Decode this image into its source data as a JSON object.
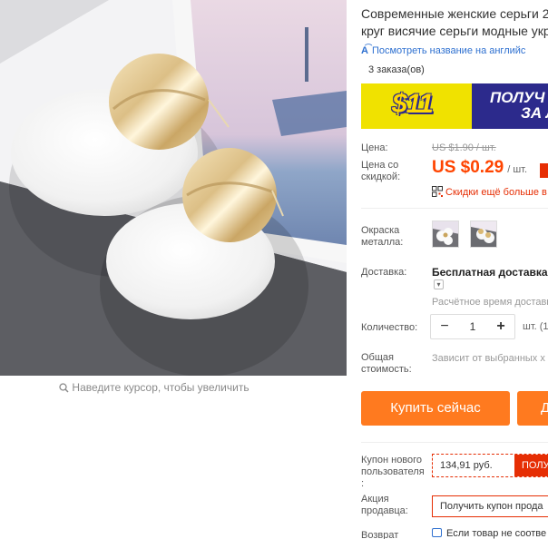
{
  "product": {
    "title_line1": "Современные женские серьги 2",
    "title_line2": "круг висячие серьги модные укр",
    "translate_link": "Посмотреть название на английс",
    "orders": "3 заказа(ов)"
  },
  "banner": {
    "amount": "$11",
    "slogan_line1": "ПОЛУЧ",
    "slogan_line2": "ЗА Л",
    "colors": {
      "background": "#2c2a8c",
      "amount_bg": "#f0e200",
      "amount": "#ffd800"
    }
  },
  "pricing": {
    "price_label": "Цена:",
    "old_price": "US $1.90 / шт.",
    "discount_label_line1": "Цена со",
    "discount_label_line2": "скидкой:",
    "price": "US $0.29",
    "unit": "/ шт.",
    "more_discounts": "Скидки ещё больше в",
    "accent_color": "#ff4400"
  },
  "options": {
    "color_label_line1": "Окраска",
    "color_label_line2": "металла:"
  },
  "shipping": {
    "label": "Доставка:",
    "title": "Бесплатная доставка в",
    "toggle": "▾",
    "eta": "Расчётное время доставк"
  },
  "quantity": {
    "label": "Количество:",
    "minus": "−",
    "value": "1",
    "plus": "+",
    "unit": "шт. (1"
  },
  "total": {
    "label_line1": "Общая",
    "label_line2": "стоимость:",
    "hint": "Зависит от выбранных х"
  },
  "actions": {
    "buy_now": "Купить сейчас",
    "add_to_cart": "Д",
    "button_color": "#ff7a1f"
  },
  "coupons": {
    "new_user_label_line1": "Купон нового",
    "new_user_label_line2": "пользователя",
    "new_user_label_line3": ":",
    "new_user_amount": "134,91 руб.",
    "new_user_get": "ПОЛУ",
    "seller_label_line1": "Акция",
    "seller_label_line2": "продавца:",
    "seller_get": "Получить купон прода"
  },
  "returns": {
    "label": "Возврат",
    "text": "Если товар не соотве"
  },
  "gallery": {
    "zoom_hint": "Наведите курсор, чтобы увеличить"
  }
}
